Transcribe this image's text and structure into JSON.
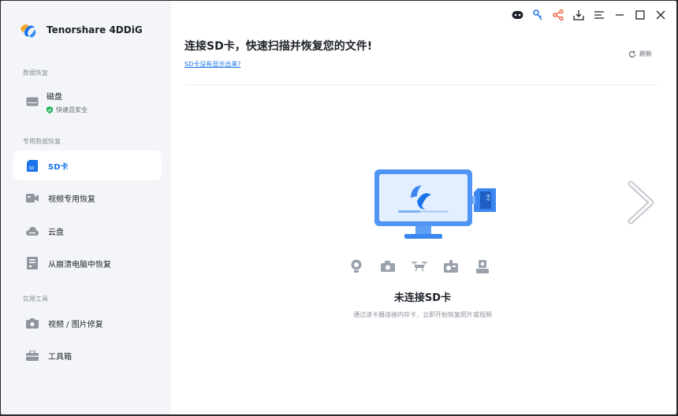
{
  "app": {
    "name": "Tenorshare 4DDiG"
  },
  "sidebar": {
    "section_data_recovery": "数据恢复",
    "disk": {
      "label": "磁盘",
      "sub": "快速且安全"
    },
    "section_special": "专用数据恢复",
    "items": [
      {
        "label": "SD卡",
        "icon": "sd-card-icon",
        "active": true
      },
      {
        "label": "视频专用恢复",
        "icon": "video-camera-icon"
      },
      {
        "label": "云盘",
        "icon": "cloud-icon"
      },
      {
        "label": "从崩溃电脑中恢复",
        "icon": "crashed-pc-icon"
      }
    ],
    "section_tools": "实用工具",
    "tools": [
      {
        "label": "视频 / 图片修复",
        "icon": "photo-repair-icon"
      },
      {
        "label": "工具箱",
        "icon": "toolbox-icon"
      }
    ]
  },
  "titlebar": {
    "icons": [
      "chat-bot-icon",
      "key-icon",
      "share-icon",
      "download-icon",
      "menu-icon",
      "minimize-icon",
      "maximize-icon",
      "close-icon"
    ]
  },
  "main": {
    "title": "连接SD卡，快速扫描并恢复您的文件!",
    "link": "SD卡没有显示出来?",
    "refresh": "刷新",
    "status_title": "未连接SD卡",
    "status_sub": "通过读卡器连接内存卡，立即开始恢复照片或视频",
    "device_icons": [
      "webcam-icon",
      "camera-icon",
      "drone-icon",
      "action-camera-icon",
      "dashcam-icon"
    ]
  },
  "colors": {
    "accent": "#1a73e8",
    "sidebar_bg": "#f3f5f9",
    "share": "#f0603a"
  }
}
